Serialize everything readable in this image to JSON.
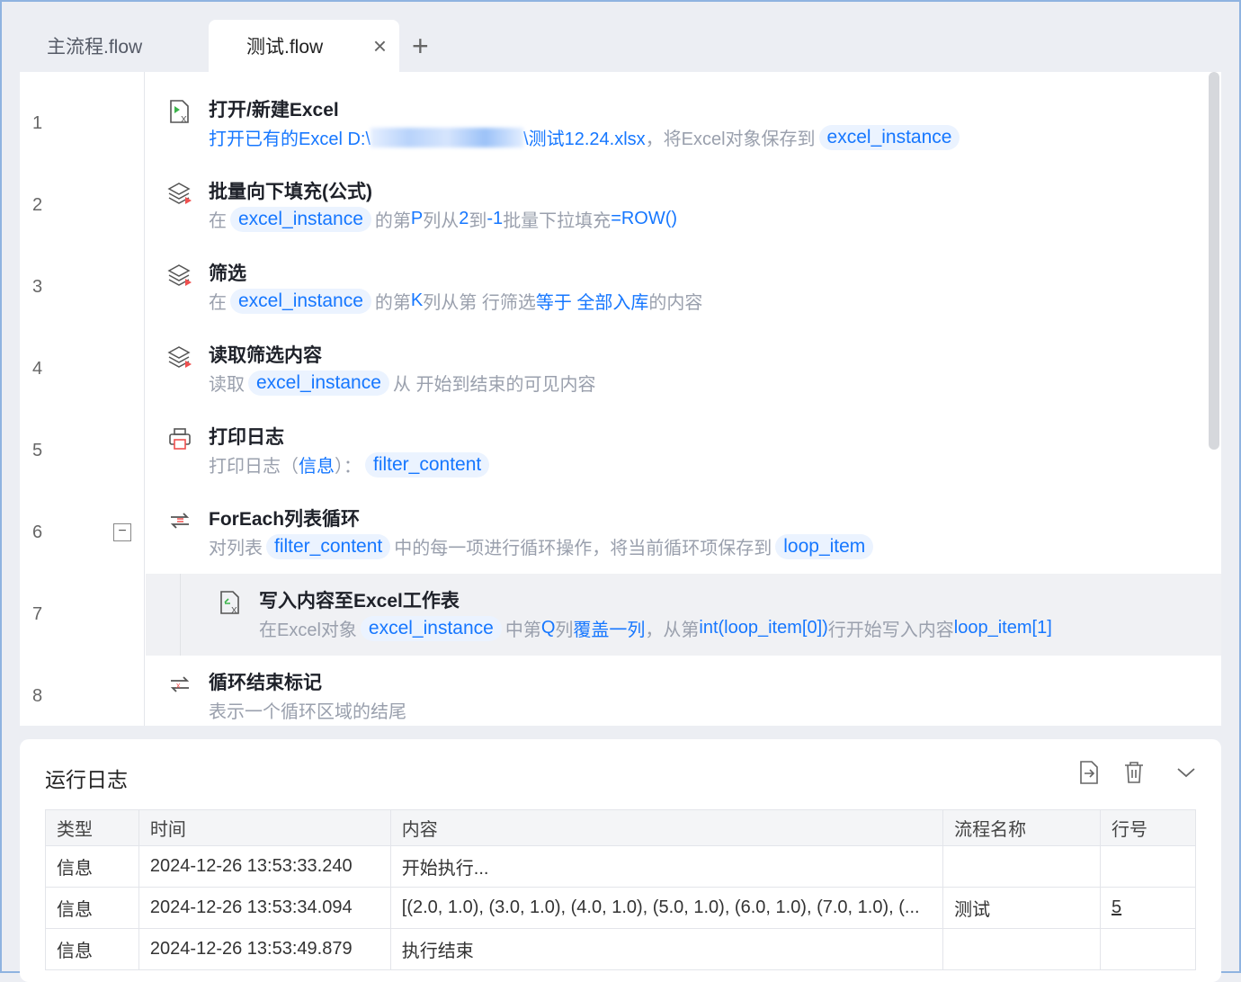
{
  "tabs": [
    {
      "label": "主流程.flow"
    },
    {
      "label": "测试.flow",
      "close": "×"
    }
  ],
  "add_tab": "+",
  "lines": [
    "1",
    "2",
    "3",
    "4",
    "5",
    "6",
    "7",
    "8"
  ],
  "fold": "−",
  "steps": [
    {
      "title": "打开/新建Excel",
      "s": [
        [
          "b",
          "打开已有的Excel D:\\"
        ],
        [
          "blur",
          ""
        ],
        [
          "b",
          "\\测试12.24.xlsx"
        ],
        [
          "g",
          "，将Excel对象保存到"
        ],
        [
          "c",
          "excel_instance"
        ]
      ]
    },
    {
      "title": "批量向下填充(公式)",
      "s": [
        [
          "g",
          "在"
        ],
        [
          "c",
          "excel_instance"
        ],
        [
          "g",
          "的第 "
        ],
        [
          "b",
          "P"
        ],
        [
          "g",
          " 列从 "
        ],
        [
          "b",
          "2"
        ],
        [
          "g",
          " 到 "
        ],
        [
          "b",
          "-1"
        ],
        [
          "g",
          " 批量下拉填充 "
        ],
        [
          "b",
          "=ROW()"
        ]
      ]
    },
    {
      "title": "筛选",
      "s": [
        [
          "g",
          "在"
        ],
        [
          "c",
          "excel_instance"
        ],
        [
          "g",
          "的第 "
        ],
        [
          "b",
          "K"
        ],
        [
          "g",
          " 列从第  行筛选 "
        ],
        [
          "b",
          "等于 全部入库"
        ],
        [
          "g",
          " 的内容"
        ]
      ]
    },
    {
      "title": "读取筛选内容",
      "s": [
        [
          "g",
          "读取"
        ],
        [
          "c",
          "excel_instance"
        ],
        [
          "g",
          "从  开始到结束的可见内容"
        ]
      ]
    },
    {
      "title": "打印日志",
      "s": [
        [
          "g",
          "打印日志（"
        ],
        [
          "b",
          "信息"
        ],
        [
          "g",
          "）："
        ],
        [
          "c",
          "filter_content"
        ]
      ]
    },
    {
      "title": "ForEach列表循环",
      "s": [
        [
          "g",
          "对列表"
        ],
        [
          "c",
          "filter_content"
        ],
        [
          "g",
          "中的每一项进行循环操作，将当前循环项保存到"
        ],
        [
          "c",
          "loop_item"
        ]
      ]
    },
    {
      "title": "写入内容至Excel工作表",
      "s": [
        [
          "g",
          "在Excel对象"
        ],
        [
          "c",
          "excel_instance"
        ],
        [
          "g",
          "中第"
        ],
        [
          "b",
          "Q"
        ],
        [
          "g",
          "列"
        ],
        [
          "b",
          "覆盖一列"
        ],
        [
          "g",
          "，从第"
        ],
        [
          "b",
          "int(loop_item[0])"
        ],
        [
          "g",
          "行开始写入内容"
        ],
        [
          "b",
          "loop_item[1]"
        ]
      ]
    },
    {
      "title": "循环结束标记",
      "s": [
        [
          "g",
          "表示一个循环区域的结尾"
        ]
      ]
    }
  ],
  "log": {
    "title": "运行日志",
    "headers": [
      "类型",
      "时间",
      "内容",
      "流程名称",
      "行号"
    ],
    "rows": [
      [
        "信息",
        "2024-12-26 13:53:33.240",
        "开始执行...",
        "",
        ""
      ],
      [
        "信息",
        "2024-12-26 13:53:34.094",
        "[(2.0, 1.0), (3.0, 1.0), (4.0, 1.0), (5.0, 1.0), (6.0, 1.0), (7.0, 1.0), (...",
        "测试",
        "5"
      ],
      [
        "信息",
        "2024-12-26 13:53:49.879",
        "执行结束",
        "",
        ""
      ]
    ]
  }
}
